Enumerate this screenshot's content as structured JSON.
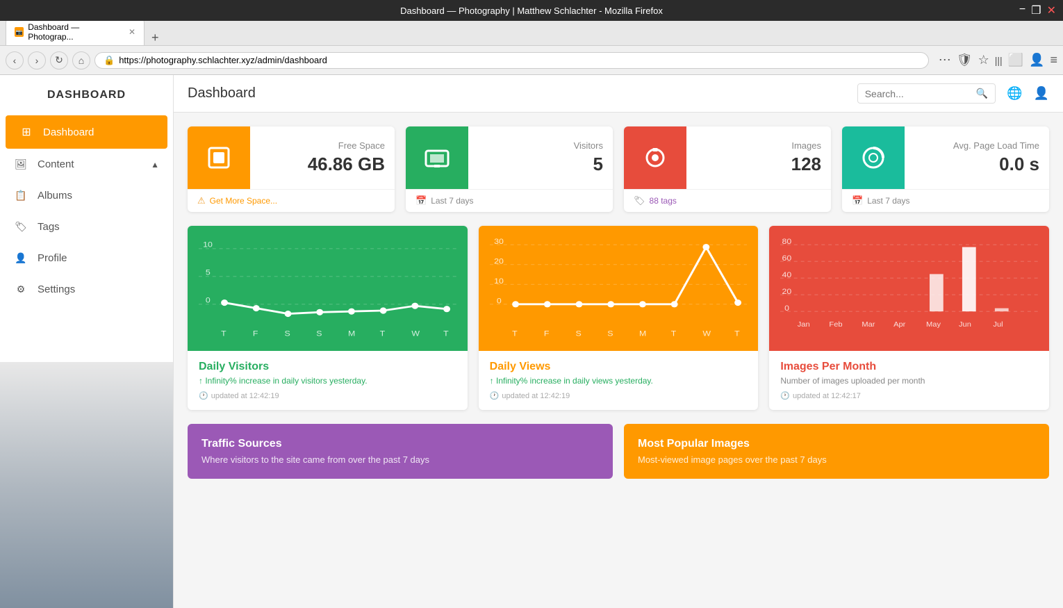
{
  "browser": {
    "title": "Dashboard — Photography | Matthew Schlachter - Mozilla Firefox",
    "tab_label": "Dashboard — Photograp...",
    "url": "https://photography.schlachter.xyz/admin/dashboard",
    "new_tab_label": "+"
  },
  "header": {
    "title": "Dashboard",
    "search_placeholder": "Search...",
    "globe_icon": "🌐",
    "user_icon": "👤"
  },
  "sidebar": {
    "title": "DASHBOARD",
    "items": [
      {
        "label": "Dashboard",
        "icon": "⊞",
        "active": true
      },
      {
        "label": "Content",
        "icon": "🖼",
        "active": false,
        "arrow": "▲"
      },
      {
        "label": "Albums",
        "icon": "📋",
        "active": false
      },
      {
        "label": "Tags",
        "icon": "🏷",
        "active": false
      },
      {
        "label": "Profile",
        "icon": "👤",
        "active": false
      },
      {
        "label": "Settings",
        "icon": "⚙",
        "active": false
      }
    ]
  },
  "stats": [
    {
      "icon": "📄",
      "color": "bg-orange",
      "label": "Free Space",
      "value": "46.86 GB",
      "footer_type": "warn",
      "footer_text": "Get More Space..."
    },
    {
      "icon": "🏪",
      "color": "bg-green",
      "label": "Visitors",
      "value": "5",
      "footer_type": "calendar",
      "footer_text": "Last 7 days"
    },
    {
      "icon": "📷",
      "color": "bg-red",
      "label": "Images",
      "value": "128",
      "footer_type": "tag",
      "footer_text": "88 tags"
    },
    {
      "icon": "⏱",
      "color": "bg-teal",
      "label": "Avg. Page Load Time",
      "value": "0.0 s",
      "footer_type": "calendar",
      "footer_text": "Last 7 days"
    }
  ],
  "charts": [
    {
      "title": "Daily Visitors",
      "title_color": "green",
      "subtitle": "Infinity% increase in daily visitors yesterday.",
      "subtitle_type": "arrow",
      "updated": "updated at 12:42:19",
      "bg": "#27ae60",
      "x_labels": [
        "T",
        "F",
        "S",
        "S",
        "M",
        "T",
        "W",
        "T"
      ],
      "y_labels": [
        "10",
        "5",
        "0"
      ],
      "type": "line"
    },
    {
      "title": "Daily Views",
      "title_color": "orange",
      "subtitle": "Infinity% increase in daily views yesterday.",
      "subtitle_type": "arrow",
      "updated": "updated at 12:42:19",
      "bg": "#f90",
      "x_labels": [
        "T",
        "F",
        "S",
        "S",
        "M",
        "T",
        "W",
        "T"
      ],
      "y_labels": [
        "30",
        "20",
        "10",
        "0"
      ],
      "type": "line"
    },
    {
      "title": "Images Per Month",
      "title_color": "red",
      "subtitle": "Number of images uploaded per month",
      "subtitle_type": "gray",
      "updated": "updated at 12:42:17",
      "bg": "#e74c3c",
      "x_labels": [
        "Jan",
        "Feb",
        "Mar",
        "Apr",
        "May",
        "Jun",
        "Jul"
      ],
      "y_labels": [
        "80",
        "60",
        "40",
        "20",
        "0"
      ],
      "type": "bar"
    }
  ],
  "bottom_cards": [
    {
      "title": "Traffic Sources",
      "subtitle": "Where visitors to the site came from over the past 7 days",
      "color": "purple"
    },
    {
      "title": "Most Popular Images",
      "subtitle": "Most-viewed image pages over the past 7 days",
      "color": "orange"
    }
  ]
}
